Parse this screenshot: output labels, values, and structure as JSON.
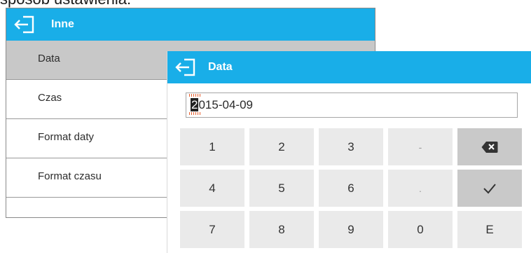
{
  "top_caption": "sposób ustawienia:",
  "back_panel": {
    "title": "Inne",
    "items": [
      {
        "label": "Data"
      },
      {
        "label": "Czas"
      },
      {
        "label": "Format daty"
      },
      {
        "label": "Format czasu"
      }
    ]
  },
  "date_dialog": {
    "title": "Data",
    "value_first_char": "2",
    "value_rest": "015-04-09",
    "keys": [
      "1",
      "2",
      "3",
      "-",
      "4",
      "5",
      "6",
      ".",
      "7",
      "8",
      "9",
      "0",
      "E"
    ]
  },
  "colors": {
    "accent": "#19aee8",
    "selected_row": "#c8c8c8",
    "key_light": "#eaeaea",
    "key_dark": "#c9c9c9"
  },
  "icons": {
    "back": "exit-arrow-icon",
    "backspace": "backspace-icon",
    "confirm": "checkmark-icon"
  }
}
